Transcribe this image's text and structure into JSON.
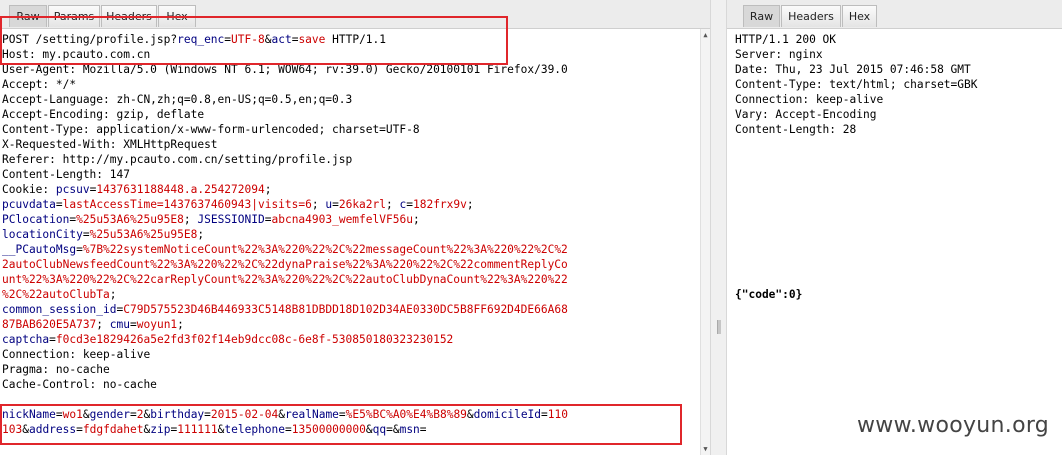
{
  "request": {
    "tabs": [
      "Raw",
      "Params",
      "Headers",
      "Hex"
    ],
    "lines": [
      [
        {
          "t": "POST /setting/profile.jsp?"
        },
        {
          "t": "req_enc",
          "c": "k"
        },
        {
          "t": "="
        },
        {
          "t": "UTF-8",
          "c": "v"
        },
        {
          "t": "&"
        },
        {
          "t": "act",
          "c": "k"
        },
        {
          "t": "="
        },
        {
          "t": "save",
          "c": "v"
        },
        {
          "t": " HTTP/1.1"
        }
      ],
      [
        {
          "t": "Host: my.pcauto.com.cn"
        }
      ],
      [
        {
          "t": "User-Agent: Mozilla/5.0 (Windows NT 6.1; WOW64; rv:39.0) Gecko/20100101 Firefox/39.0"
        }
      ],
      [
        {
          "t": "Accept: */*"
        }
      ],
      [
        {
          "t": "Accept-Language: zh-CN,zh;q=0.8,en-US;q=0.5,en;q=0.3"
        }
      ],
      [
        {
          "t": "Accept-Encoding: gzip, deflate"
        }
      ],
      [
        {
          "t": "Content-Type: application/x-www-form-urlencoded; charset=UTF-8"
        }
      ],
      [
        {
          "t": "X-Requested-With: XMLHttpRequest"
        }
      ],
      [
        {
          "t": "Referer: http://my.pcauto.com.cn/setting/profile.jsp"
        }
      ],
      [
        {
          "t": "Content-Length: 147"
        }
      ],
      [
        {
          "t": "Cookie: "
        },
        {
          "t": "pcsuv",
          "c": "k"
        },
        {
          "t": "="
        },
        {
          "t": "1437631188448.a.254272094",
          "c": "v"
        },
        {
          "t": ";"
        }
      ],
      [
        {
          "t": "pcuvdata",
          "c": "k"
        },
        {
          "t": "="
        },
        {
          "t": "lastAccessTime=1437637460943|visits=6",
          "c": "v"
        },
        {
          "t": "; "
        },
        {
          "t": "u",
          "c": "k"
        },
        {
          "t": "="
        },
        {
          "t": "26ka2rl",
          "c": "v"
        },
        {
          "t": "; "
        },
        {
          "t": "c",
          "c": "k"
        },
        {
          "t": "="
        },
        {
          "t": "182frx9v",
          "c": "v"
        },
        {
          "t": ";"
        }
      ],
      [
        {
          "t": "PClocation",
          "c": "k"
        },
        {
          "t": "="
        },
        {
          "t": "%25u53A6%25u95E8",
          "c": "v"
        },
        {
          "t": "; "
        },
        {
          "t": "JSESSIONID",
          "c": "k"
        },
        {
          "t": "="
        },
        {
          "t": "abcna4903_wemfelVF56u",
          "c": "v"
        },
        {
          "t": ";"
        }
      ],
      [
        {
          "t": "locationCity",
          "c": "k"
        },
        {
          "t": "="
        },
        {
          "t": "%25u53A6%25u95E8",
          "c": "v"
        },
        {
          "t": ";"
        }
      ],
      [
        {
          "t": "__PCautoMsg",
          "c": "k"
        },
        {
          "t": "="
        },
        {
          "t": "%7B%22systemNoticeCount%22%3A%220%22%2C%22messageCount%22%3A%220%22%2C%2",
          "c": "v"
        }
      ],
      [
        {
          "t": "2autoClubNewsfeedCount%22%3A%220%22%2C%22dynaPraise%22%3A%220%22%2C%22commentReplyCo",
          "c": "v"
        }
      ],
      [
        {
          "t": "unt%22%3A%220%22%2C%22carReplyCount%22%3A%220%22%2C%22autoClubDynaCount%22%3A%220%22",
          "c": "v"
        }
      ],
      [
        {
          "t": "%2C%22autoClubTa",
          "c": "v"
        },
        {
          "t": ";"
        }
      ],
      [
        {
          "t": "common_session_id",
          "c": "k"
        },
        {
          "t": "="
        },
        {
          "t": "C79D575523D46B446933C5148B81DBDD18D102D34AE0330DC5B8FF692D4DE66A68",
          "c": "v"
        }
      ],
      [
        {
          "t": "87BAB620E5A737",
          "c": "v"
        },
        {
          "t": "; "
        },
        {
          "t": "cmu",
          "c": "k"
        },
        {
          "t": "="
        },
        {
          "t": "woyun1",
          "c": "v"
        },
        {
          "t": ";"
        }
      ],
      [
        {
          "t": "captcha",
          "c": "k"
        },
        {
          "t": "="
        },
        {
          "t": "f0cd3e1829426a5e2fd3f02f14eb9dcc08c-6e8f-530850180323230152",
          "c": "v"
        }
      ],
      [
        {
          "t": "Connection: keep-alive"
        }
      ],
      [
        {
          "t": "Pragma: no-cache"
        }
      ],
      [
        {
          "t": "Cache-Control: no-cache"
        }
      ],
      [
        {
          "t": ""
        }
      ],
      [
        {
          "t": "nickName",
          "c": "k"
        },
        {
          "t": "="
        },
        {
          "t": "wo1",
          "c": "v"
        },
        {
          "t": "&"
        },
        {
          "t": "gender",
          "c": "k"
        },
        {
          "t": "="
        },
        {
          "t": "2",
          "c": "v"
        },
        {
          "t": "&"
        },
        {
          "t": "birthday",
          "c": "k"
        },
        {
          "t": "="
        },
        {
          "t": "2015-02-04",
          "c": "v"
        },
        {
          "t": "&"
        },
        {
          "t": "realName",
          "c": "k"
        },
        {
          "t": "="
        },
        {
          "t": "%E5%BC%A0%E4%B8%89",
          "c": "v"
        },
        {
          "t": "&"
        },
        {
          "t": "domicileId",
          "c": "k"
        },
        {
          "t": "="
        },
        {
          "t": "110",
          "c": "v"
        }
      ],
      [
        {
          "t": "103",
          "c": "v"
        },
        {
          "t": "&"
        },
        {
          "t": "address",
          "c": "k"
        },
        {
          "t": "="
        },
        {
          "t": "fdgfdahet",
          "c": "v"
        },
        {
          "t": "&"
        },
        {
          "t": "zip",
          "c": "k"
        },
        {
          "t": "="
        },
        {
          "t": "111111",
          "c": "v"
        },
        {
          "t": "&"
        },
        {
          "t": "telephone",
          "c": "k"
        },
        {
          "t": "="
        },
        {
          "t": "13500000000",
          "c": "v"
        },
        {
          "t": "&"
        },
        {
          "t": "qq",
          "c": "k"
        },
        {
          "t": "=&"
        },
        {
          "t": "msn",
          "c": "k"
        },
        {
          "t": "="
        }
      ]
    ]
  },
  "response": {
    "tabs": [
      "Raw",
      "Headers",
      "Hex"
    ],
    "lines": [
      "HTTP/1.1 200 OK",
      "Server: nginx",
      "Date: Thu, 23 Jul 2015 07:46:58 GMT",
      "Content-Type: text/html; charset=GBK",
      "Connection: keep-alive",
      "Vary: Accept-Encoding",
      "Content-Length: 28"
    ],
    "body": "{\"code\":0}"
  },
  "watermark": "www.wooyun.org"
}
